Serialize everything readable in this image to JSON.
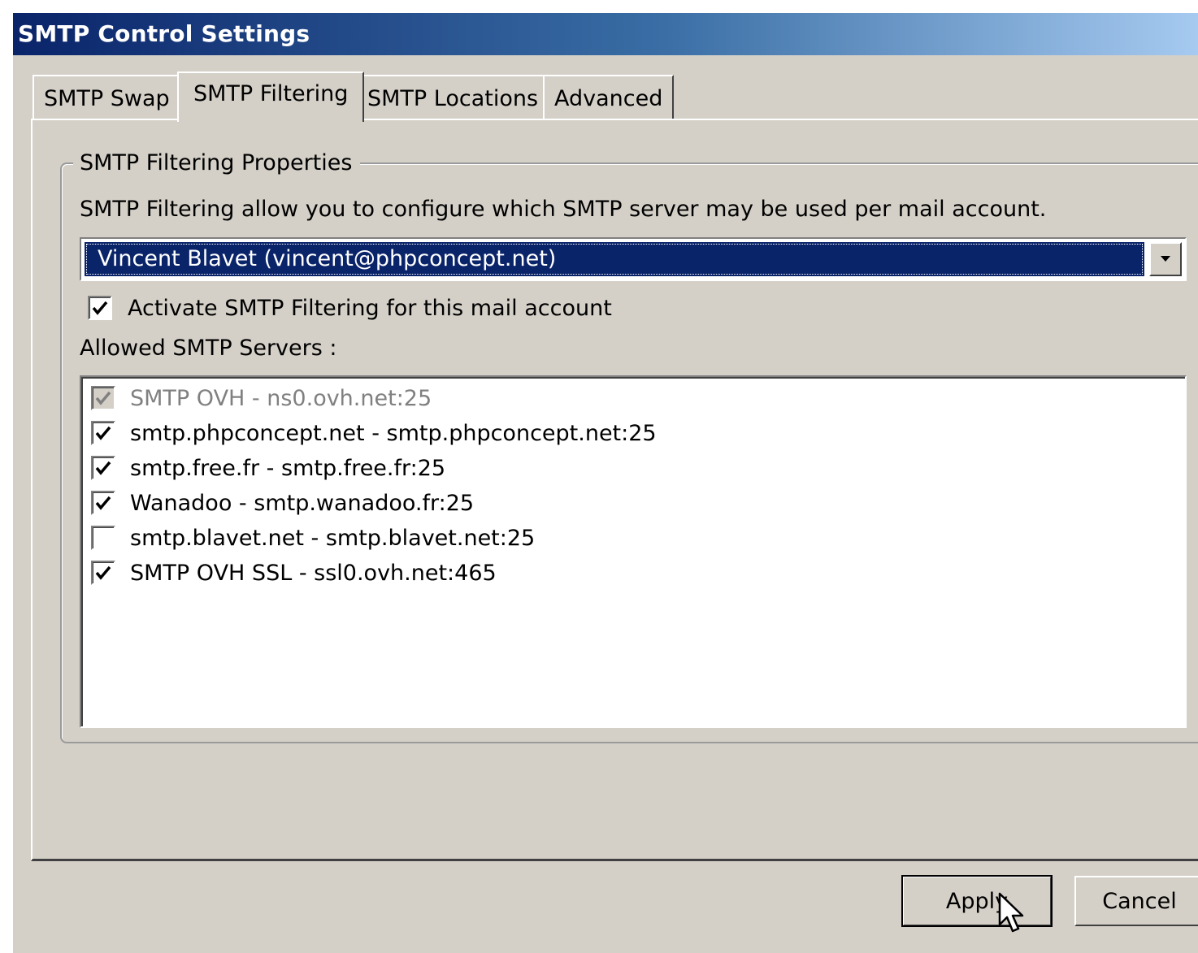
{
  "window": {
    "title": "SMTP Control Settings"
  },
  "tabs": [
    {
      "label": "SMTP Swap",
      "active": false
    },
    {
      "label": "SMTP Filtering",
      "active": true
    },
    {
      "label": "SMTP Locations",
      "active": false
    },
    {
      "label": "Advanced",
      "active": false
    }
  ],
  "filtering": {
    "group_title": "SMTP Filtering Properties",
    "description": "SMTP Filtering allow you to configure which SMTP server may be used per mail account.",
    "account_select": {
      "value": "Vincent Blavet (vincent@phpconcept.net)"
    },
    "activate_checkbox": {
      "label": "Activate SMTP Filtering for this mail account",
      "checked": true
    },
    "allowed_label": "Allowed SMTP Servers :",
    "servers": [
      {
        "label": "SMTP OVH - ns0.ovh.net:25",
        "checked": true,
        "disabled": true
      },
      {
        "label": "smtp.phpconcept.net - smtp.phpconcept.net:25",
        "checked": true,
        "disabled": false
      },
      {
        "label": "smtp.free.fr - smtp.free.fr:25",
        "checked": true,
        "disabled": false
      },
      {
        "label": "Wanadoo - smtp.wanadoo.fr:25",
        "checked": true,
        "disabled": false
      },
      {
        "label": "smtp.blavet.net - smtp.blavet.net:25",
        "checked": false,
        "disabled": false
      },
      {
        "label": "SMTP OVH SSL - ssl0.ovh.net:465",
        "checked": true,
        "disabled": false
      }
    ]
  },
  "buttons": {
    "apply_label": "Apply",
    "cancel_label": "Cancel"
  },
  "icons": {
    "combo_arrow": "chevron-down-icon",
    "check_mark": "check-icon",
    "cursor": "mouse-pointer-icon"
  },
  "colors": {
    "face": "#d4d0c8",
    "title_start": "#0a246a",
    "title_end": "#a6caf0",
    "selection": "#0a246a"
  }
}
